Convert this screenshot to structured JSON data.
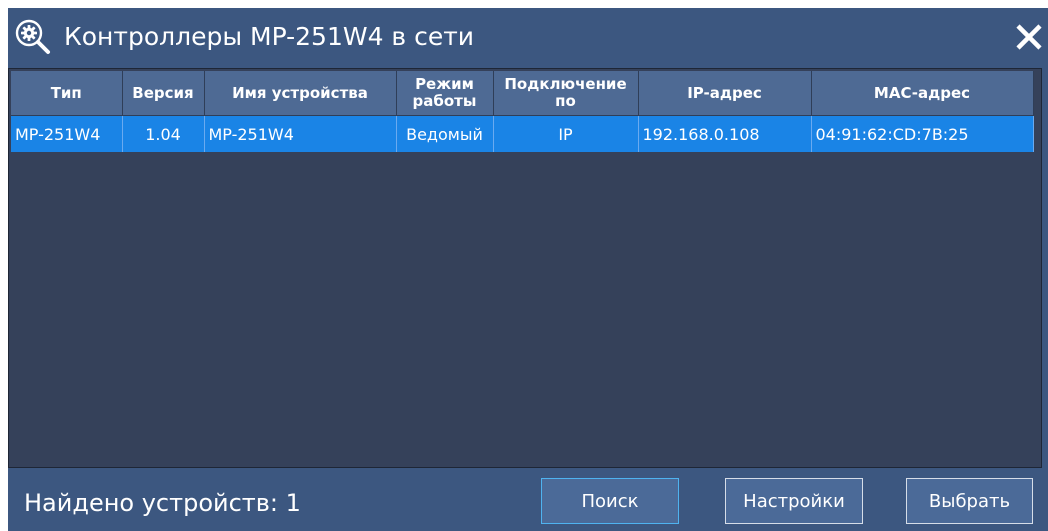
{
  "window": {
    "title": "Контроллеры MP-251W4 в сети",
    "close_symbol": "✕"
  },
  "table": {
    "columns": [
      {
        "label": "Тип"
      },
      {
        "label": "Версия"
      },
      {
        "label": "Имя устройства"
      },
      {
        "label": "Режим работы"
      },
      {
        "label": "Подключение по"
      },
      {
        "label": "IP-адрес"
      },
      {
        "label": "MAC-адрес"
      }
    ],
    "rows": [
      {
        "type": "MP-251W4",
        "version": "1.04",
        "name": "MP-251W4",
        "mode": "Ведомый",
        "connection": "IP",
        "ip": "192.168.0.108",
        "mac": "04:91:62:CD:7B:25",
        "selected": true
      }
    ]
  },
  "footer": {
    "found_label": "Найдено устройств: 1",
    "search_label": "Поиск",
    "settings_label": "Настройки",
    "select_label": "Выбрать"
  },
  "colors": {
    "window_bg": "#3c5780",
    "list_bg": "#35415a",
    "header_bg": "#4e6a94",
    "selected_row": "#1a84e6",
    "focus_border": "#4fb3f0"
  },
  "icons": {
    "title": "search-gear-icon",
    "close": "close-icon"
  }
}
